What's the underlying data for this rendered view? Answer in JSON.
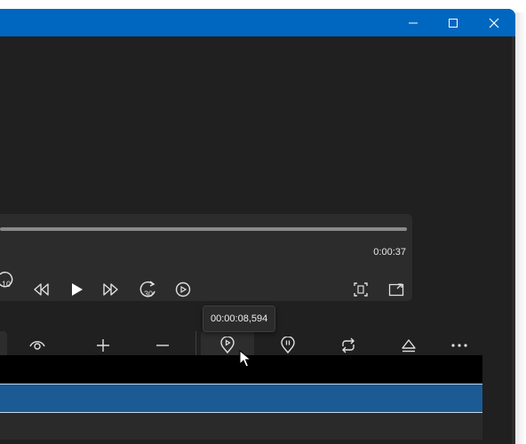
{
  "window": {
    "titlebar_color": "#0067c0",
    "controls": [
      {
        "name": "minimize-button",
        "icon": "minimize-icon"
      },
      {
        "name": "maximize-button",
        "icon": "maximize-icon"
      },
      {
        "name": "close-button",
        "icon": "close-icon"
      }
    ]
  },
  "player": {
    "total_time": "0:00:37",
    "progress": 0.0,
    "controls": {
      "skip_back": {
        "icon": "skip-back-10-icon",
        "label": "10"
      },
      "rewind": {
        "icon": "rewind-icon"
      },
      "play": {
        "icon": "play-icon"
      },
      "fast_forward": {
        "icon": "fast-forward-icon"
      },
      "skip_forward": {
        "icon": "skip-forward-30-icon",
        "label": "30"
      },
      "refresh": {
        "icon": "repeat-play-icon"
      },
      "fit": {
        "icon": "fit-screen-icon"
      },
      "popout": {
        "icon": "mini-player-icon"
      }
    }
  },
  "toolbar": {
    "tooltip": "00:00:08,594",
    "buttons": [
      {
        "name": "visibility-button",
        "icon": "eye-icon"
      },
      {
        "name": "zoom-in-button",
        "icon": "plus-icon"
      },
      {
        "name": "zoom-out-button",
        "icon": "minus-icon"
      },
      {
        "name": "add-marker-button",
        "icon": "marker-play-icon"
      },
      {
        "name": "pause-marker-button",
        "icon": "marker-pause-icon"
      },
      {
        "name": "loop-button",
        "icon": "loop-icon"
      },
      {
        "name": "eject-button",
        "icon": "eject-icon"
      },
      {
        "name": "more-options-button",
        "icon": "ellipsis-icon"
      }
    ]
  },
  "timeline": {
    "selection_color": "#1c5a94"
  }
}
